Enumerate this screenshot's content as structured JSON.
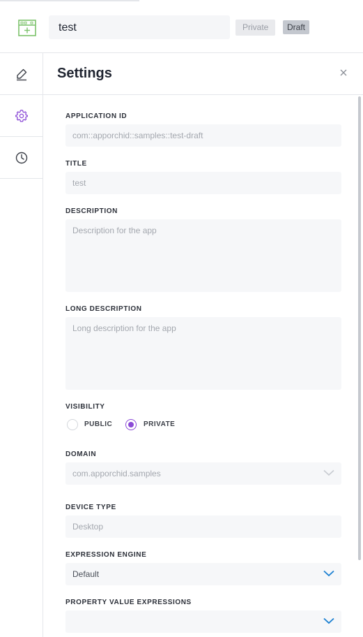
{
  "header": {
    "app_name": "test",
    "badge_private": "Private",
    "badge_draft": "Draft"
  },
  "rail": {
    "items": [
      "edit-pen-icon",
      "settings-gear-icon",
      "history-clock-icon"
    ],
    "active_color": "#8b4ad6"
  },
  "panel": {
    "title": "Settings",
    "fields": {
      "application_id": {
        "label": "APPLICATION ID",
        "value": "com::apporchid::samples::test-draft"
      },
      "title": {
        "label": "TITLE",
        "value": "test"
      },
      "description": {
        "label": "DESCRIPTION",
        "placeholder": "Description for the app"
      },
      "long_description": {
        "label": "LONG DESCRIPTION",
        "placeholder": "Long description for the app"
      },
      "visibility": {
        "label": "VISIBILITY",
        "options": [
          "PUBLIC",
          "PRIVATE"
        ],
        "selected": "PRIVATE"
      },
      "domain": {
        "label": "DOMAIN",
        "value": "com.apporchid.samples"
      },
      "device_type": {
        "label": "DEVICE TYPE",
        "value": "Desktop"
      },
      "expression_engine": {
        "label": "EXPRESSION ENGINE",
        "value": "Default"
      },
      "property_value_expressions": {
        "label": "PROPERTY VALUE EXPRESSIONS",
        "value": ""
      }
    }
  },
  "colors": {
    "accent": "#8b4ad6",
    "chevron_active": "#1a7fd1",
    "chevron_disabled": "#c8cbd1",
    "app_icon": "#7cc26b"
  }
}
